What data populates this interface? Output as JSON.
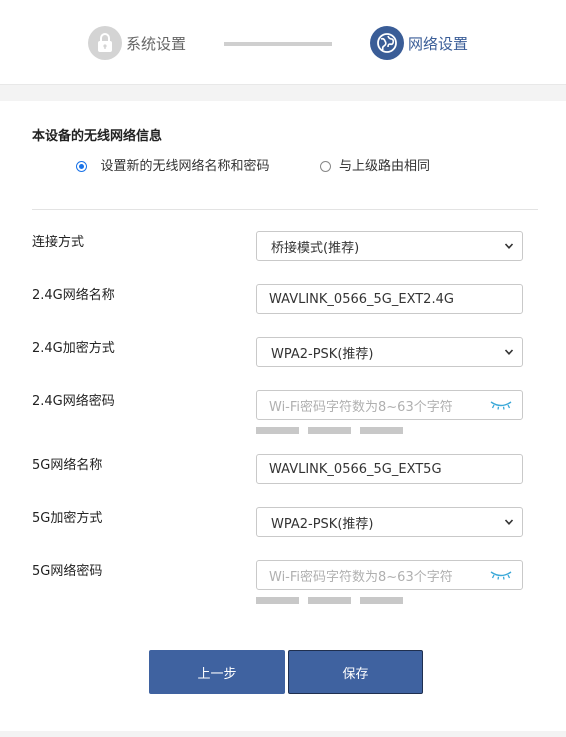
{
  "stepper": {
    "step1_label": "系统设置",
    "step2_label": "网络设置"
  },
  "section": {
    "title": "本设备的无线网络信息",
    "radio_options": [
      {
        "label": "设置新的无线网络名称和密码",
        "checked": true
      },
      {
        "label": "与上级路由相同",
        "checked": false
      }
    ]
  },
  "form": {
    "connection_mode": {
      "label": "连接方式",
      "value": "桥接模式(推荐)"
    },
    "ssid_24": {
      "label": "2.4G网络名称",
      "value": "WAVLINK_0566_5G_EXT2.4G"
    },
    "encryption_24": {
      "label": "2.4G加密方式",
      "value": "WPA2-PSK(推荐)"
    },
    "password_24": {
      "label": "2.4G网络密码",
      "placeholder": "Wi-Fi密码字符数为8~63个字符"
    },
    "ssid_5": {
      "label": "5G网络名称",
      "value": "WAVLINK_0566_5G_EXT5G"
    },
    "encryption_5": {
      "label": "5G加密方式",
      "value": "WPA2-PSK(推荐)"
    },
    "password_5": {
      "label": "5G网络密码",
      "placeholder": "Wi-Fi密码字符数为8~63个字符"
    }
  },
  "buttons": {
    "prev": "上一步",
    "save": "保存"
  },
  "icons": {
    "step1": "lock-icon",
    "step2": "globe-icon",
    "dropdown": "chevron-down-icon",
    "password_toggle": "eye-closed-icon"
  },
  "colors": {
    "accent": "#3a5d97",
    "button": "#3f62a0",
    "radio_checked": "#1a73e8",
    "eye_icon": "#3aa8d8"
  }
}
